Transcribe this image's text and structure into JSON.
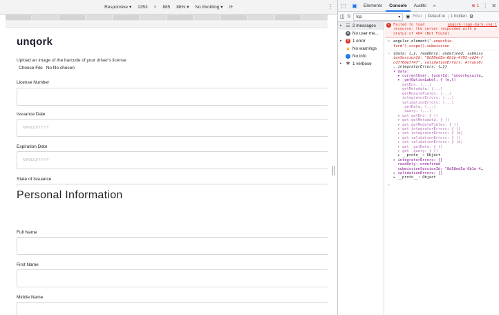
{
  "device_toolbar": {
    "device": "Responsive ▾",
    "width": "1353",
    "times": "×",
    "height": "885",
    "zoom": "88% ▾",
    "throttling": "No throttling ▾",
    "rotate_icon": "⟳",
    "menu_icon": "⋮"
  },
  "form": {
    "logo": "unqork",
    "upload_label": "Upload an image of the barcode of your driver's license",
    "choose_file": "Choose File",
    "no_file": "No file chosen",
    "fields": [
      {
        "label": "License Number",
        "placeholder": ""
      },
      {
        "label": "Issuance Date",
        "placeholder": "MM/DD/YYYY"
      },
      {
        "label": "Expiration Date",
        "placeholder": "MM/DD/YYYY"
      },
      {
        "label": "State of Issuance",
        "placeholder": ""
      }
    ],
    "section_title": "Personal Information",
    "personal_fields": [
      {
        "label": "Full Name",
        "placeholder": ""
      },
      {
        "label": "First Name",
        "placeholder": ""
      },
      {
        "label": "Middle Name",
        "placeholder": ""
      }
    ]
  },
  "devtools": {
    "tabs": [
      "Elements",
      "Console",
      "Audits",
      "»"
    ],
    "active_tab": "Console",
    "error_badge": "⊗ 1",
    "context": "top",
    "filter_placeholder": "Filter",
    "default_levels": "Default le",
    "hidden_count": "1 hidden",
    "sidebar": [
      {
        "label": "2 messages",
        "icon": "list-icon",
        "color": "#5f6368"
      },
      {
        "label": "No user me...",
        "icon": "user-icon",
        "color": "#5f6368"
      },
      {
        "label": "1 error",
        "icon": "error-icon",
        "color": "#d93025"
      },
      {
        "label": "No warnings",
        "icon": "warning-icon",
        "color": "#f9ab00"
      },
      {
        "label": "No info",
        "icon": "info-icon",
        "color": "#1a73e8"
      },
      {
        "label": "1 verbose",
        "icon": "bug-icon",
        "color": "#5f6368"
      }
    ],
    "console": {
      "error_text_1": "Failed to load",
      "error_link": "unqork-logo-dark.svg:1",
      "error_text_2": "resource: the server responded with a",
      "error_text_3": "status of 404 (Not Found)",
      "cmd_1": "angular.element('",
      "cmd_str": ".unqorkio-",
      "cmd_2": "form').scope().submission",
      "res_1": "{data: {…}, readOnly: undefined, submiss",
      "res_2": "ionSessionId: \"8d58ed5a-6b1e-4f93-ad24-f",
      "res_3": "cd7f0de7747\", validationErrors: Array(0)",
      "res_4": ", integratorErrors: {…}}",
      "tree": [
        {
          "text": "▾ data:",
          "cls": "k"
        },
        {
          "text": "  ▸ currentUser: {userId: \"unqorkgsuite…",
          "cls": "k"
        },
        {
          "text": "  ▸ _getOptionLabel: ƒ (e,t)",
          "cls": "k"
        },
        {
          "text": "    getEnv: (...)",
          "cls": "kd"
        },
        {
          "text": "    getMetadata: (...)",
          "cls": "kd"
        },
        {
          "text": "    getModuleFields: (...)",
          "cls": "kd"
        },
        {
          "text": "    integratorErrors: (...)",
          "cls": "kd"
        },
        {
          "text": "    validationErrors: (...)",
          "cls": "kd"
        },
        {
          "text": "    _getData: (...)",
          "cls": "kd"
        },
        {
          "text": "    _query: (...)",
          "cls": "kd"
        },
        {
          "text": "  ▸ get getEnv: ƒ ()",
          "cls": "kd"
        },
        {
          "text": "  ▸ get getMetadata: ƒ ()",
          "cls": "kd"
        },
        {
          "text": "  ▸ get getModuleFields: ƒ ()",
          "cls": "kd"
        },
        {
          "text": "  ▸ get integratorErrors: ƒ ()",
          "cls": "kd"
        },
        {
          "text": "  ▸ set integratorErrors: ƒ (e)",
          "cls": "kd"
        },
        {
          "text": "  ▸ get validationErrors: ƒ ()",
          "cls": "kd"
        },
        {
          "text": "  ▸ set validationErrors: ƒ (e)",
          "cls": "kd"
        },
        {
          "text": "  ▸ get _getData: ƒ ()",
          "cls": "kd"
        },
        {
          "text": "  ▸ get _query: ƒ ()",
          "cls": "kd"
        },
        {
          "text": "  ▸ __proto__: Object",
          "cls": ""
        },
        {
          "text": "▸ integratorErrors: {}",
          "cls": "k"
        },
        {
          "text": "  readOnly: undefined",
          "cls": "k"
        },
        {
          "text": "  submissionSessionId: \"8d58ed5a-6b1e-4…",
          "cls": "k"
        },
        {
          "text": "▸ validationErrors: []",
          "cls": "k"
        },
        {
          "text": "▸ __proto__: Object",
          "cls": ""
        }
      ]
    }
  }
}
